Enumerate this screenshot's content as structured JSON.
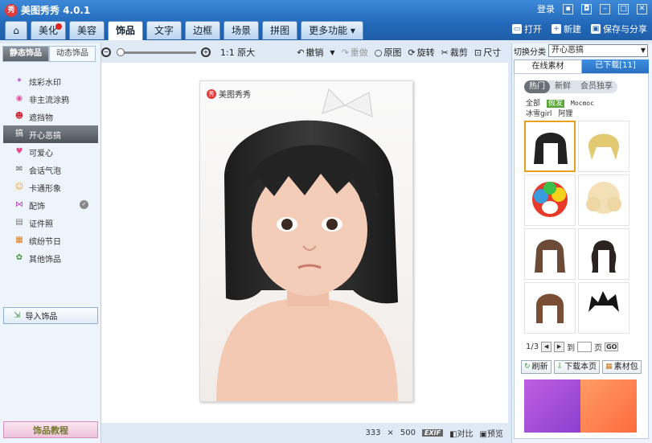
{
  "window": {
    "title": "美图秀秀 4.0.1",
    "login": "登录"
  },
  "tabs": [
    {
      "label": ""
    },
    {
      "label": "美化",
      "badge": true
    },
    {
      "label": "美容"
    },
    {
      "label": "饰品",
      "active": true
    },
    {
      "label": "文字"
    },
    {
      "label": "边框"
    },
    {
      "label": "场景"
    },
    {
      "label": "拼图"
    },
    {
      "label": "更多功能 ▾"
    }
  ],
  "top_actions": {
    "open": "打开",
    "new": "新建",
    "save_share": "保存与分享"
  },
  "toolbar": {
    "zoom_actual": "1:1 原大",
    "undo": "撤销",
    "redo": "重做",
    "original": "原图",
    "rotate": "旋转",
    "crop": "裁剪",
    "size": "尺寸"
  },
  "left": {
    "subtabs": [
      "静态饰品",
      "动态饰品"
    ],
    "categories": [
      {
        "label": "炫彩水印",
        "icon": "sparkle-icon"
      },
      {
        "label": "非主流涂鸦",
        "icon": "lips-icon"
      },
      {
        "label": "遮挡物",
        "icon": "mask-icon"
      },
      {
        "label": "开心恶搞",
        "icon": "funny-icon",
        "active": true
      },
      {
        "label": "可爱心",
        "icon": "heart-icon"
      },
      {
        "label": "会话气泡",
        "icon": "speech-bubble-icon"
      },
      {
        "label": "卡通形象",
        "icon": "cartoon-icon"
      },
      {
        "label": "配饰",
        "icon": "bow-icon",
        "shield": true
      },
      {
        "label": "证件照",
        "icon": "id-photo-icon"
      },
      {
        "label": "缤纷节日",
        "icon": "gift-icon"
      },
      {
        "label": "其他饰品",
        "icon": "flower-icon"
      }
    ],
    "import_label": "导入饰品",
    "tutorial_label": "饰品教程"
  },
  "canvas": {
    "watermark": "美图秀秀"
  },
  "status": {
    "width": "333",
    "x": "×",
    "height": "500",
    "exif": "EXIF",
    "compare": "对比",
    "preview": "预览"
  },
  "right": {
    "switch_label": "切换分类",
    "switch_value": "开心恶搞",
    "tabs": [
      "在线素材",
      "已下载[11]"
    ],
    "pills": [
      "热门",
      "新鲜",
      "会员独享"
    ],
    "tags": [
      "全部",
      "假发",
      "Mocmoc",
      "冰雪girl",
      "阿狸"
    ],
    "pager": {
      "page": "1/3",
      "to": "到",
      "unit": "页",
      "go": "GO"
    },
    "buttons": [
      "刷新",
      "下载本页",
      "素材包"
    ],
    "colors": {
      "accent_blue": "#2a6fc0",
      "selected_border": "#e8a020"
    }
  }
}
